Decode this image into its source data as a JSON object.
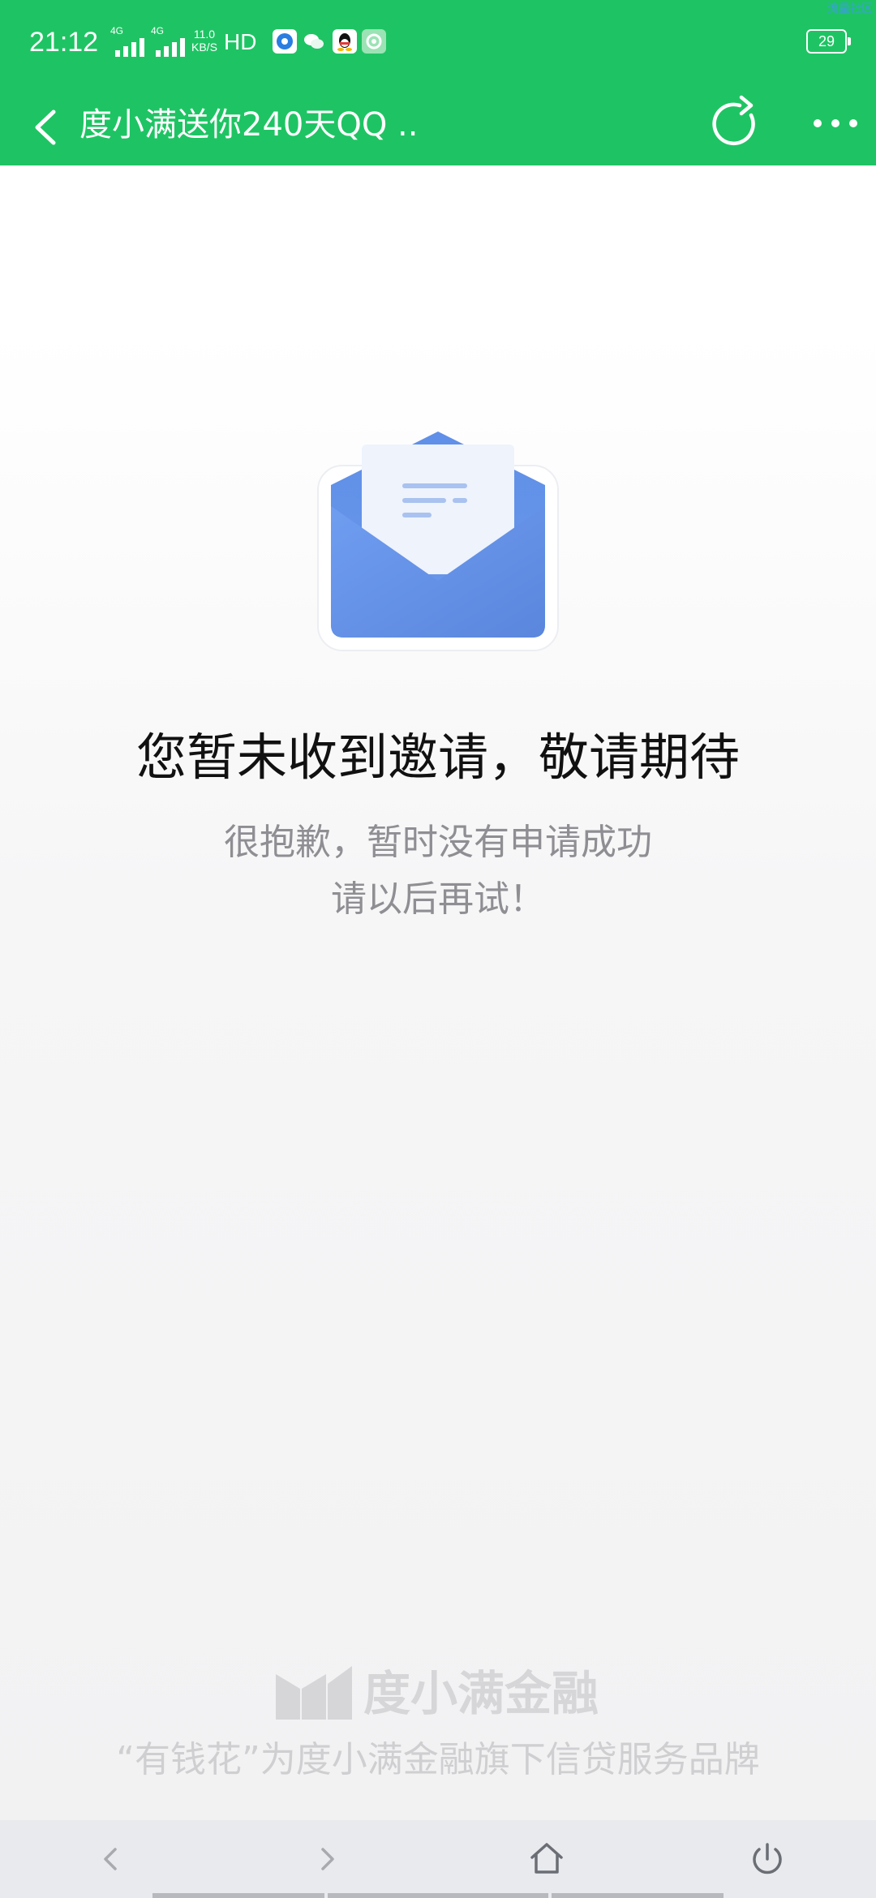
{
  "status_bar": {
    "time": "21:12",
    "network1": "4G",
    "network2": "4G",
    "speed_value": "11.0",
    "speed_unit": "KB/S",
    "hd_label": "HD",
    "battery": "29",
    "corner_text": "流量社区",
    "app_icons": [
      "browser-app-icon",
      "wechat-icon",
      "qq-icon",
      "game-app-icon"
    ]
  },
  "header": {
    "title": "度小满送你240天QQ ..",
    "icons": {
      "back": "back-arrow-icon",
      "refresh": "refresh-icon",
      "more": "more-dots-icon"
    }
  },
  "main": {
    "illustration": "envelope-icon",
    "title": "您暂未收到邀请，敬请期待",
    "subtitle_line1": "很抱歉，暂时没有申请成功",
    "subtitle_line2": "请以后再试！"
  },
  "footer": {
    "brand_name": "度小满金融",
    "tagline": "“有钱花”为度小满金融旗下信贷服务品牌"
  },
  "bottom_nav": {
    "items": [
      "back-nav-icon",
      "forward-nav-icon",
      "home-icon",
      "power-icon"
    ]
  },
  "colors": {
    "brand_green": "#1ec463",
    "envelope_blue": "#5c8ce6",
    "title_text": "#111111",
    "subtitle_text": "#8e8e93",
    "footer_text": "#cfcfd1"
  }
}
